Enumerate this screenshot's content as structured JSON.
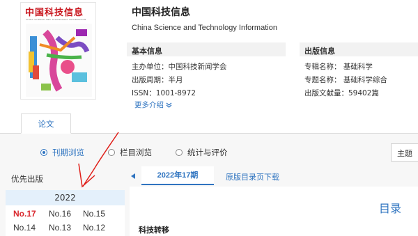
{
  "cover": {
    "title": "中国科技信息",
    "subtitle": "CHINA SCIENCE AND TECHNOLOGY INFORMATION"
  },
  "journal": {
    "name": "中国科技信息",
    "english_name": "China Science and Technology Information"
  },
  "basic_info": {
    "heading": "基本信息",
    "sponsor": "主办单位：中国科技新闻学会",
    "cycle": "出版周期：半月",
    "issn": "ISSN：1001-8972",
    "more": "更多介绍"
  },
  "publication_info": {
    "heading": "出版信息",
    "subject": "专辑名称：  基础科学",
    "topic": "专题名称：  基础科学综合",
    "count": "出版文献量：59402篇"
  },
  "tabs": {
    "papers": "论文"
  },
  "browse": {
    "by_issue": "刊期浏览",
    "by_column": "栏目浏览",
    "stats": "统计与评价",
    "selected": "by_issue"
  },
  "topic_select": {
    "value": "主题"
  },
  "left_panel": {
    "priority": "优先出版",
    "year": "2022",
    "issues": [
      "No.17",
      "No.16",
      "No.15",
      "No.14",
      "No.13",
      "No.12"
    ],
    "current_issue": "No.17"
  },
  "right_panel": {
    "issue_tab": "2022年17期",
    "download": "原版目录页下载",
    "toc": "目录",
    "section": "科技转移"
  },
  "colors": {
    "accent": "#2f74c0",
    "current_issue": "#d9262c",
    "annotation": "#e0201a"
  }
}
